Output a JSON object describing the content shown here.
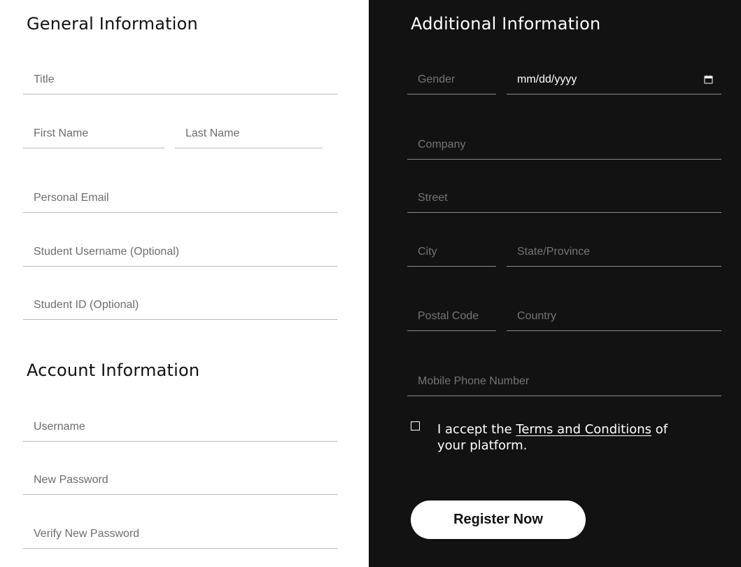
{
  "general": {
    "title": "General Information",
    "fields": {
      "title": "Title",
      "first_name": "First Name",
      "last_name": "Last Name",
      "personal_email": "Personal Email",
      "student_username": "Student Username (Optional)",
      "student_id": "Student ID (Optional)"
    }
  },
  "account": {
    "title": "Account Information",
    "fields": {
      "username": "Username",
      "new_password": "New Password",
      "verify_password": "Verify New Password"
    }
  },
  "additional": {
    "title": "Additional Information",
    "fields": {
      "gender": "Gender",
      "birth_date": "mm/dd/yyyy",
      "company": "Company",
      "street": "Street",
      "city": "City",
      "state": "State/Province",
      "postal_code": "Postal Code",
      "country": "Country",
      "mobile": "Mobile Phone Number"
    }
  },
  "terms": {
    "prefix": "I accept the ",
    "link": "Terms and Conditions",
    "suffix": " of your platform."
  },
  "register_button": "Register Now",
  "icons": {
    "calendar": "calendar-icon",
    "checkbox": "checkbox"
  },
  "colors": {
    "left_background": "#ffffff",
    "right_background": "#121212",
    "button_background": "#ffffff",
    "button_text": "#111111"
  }
}
